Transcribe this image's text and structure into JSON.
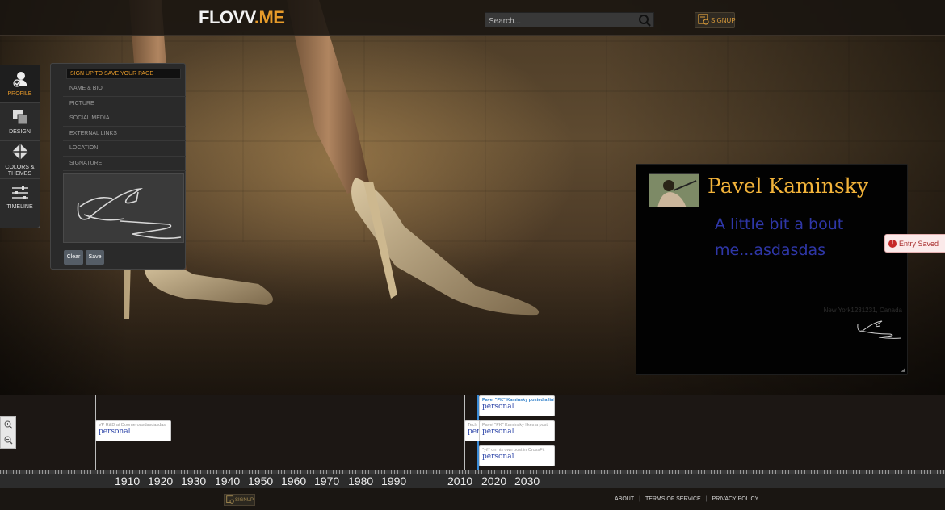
{
  "app": {
    "logo_main": "FLOVV",
    "logo_suffix": ".ME"
  },
  "header": {
    "search_placeholder": "Search...",
    "signup_label": "SIGNUP"
  },
  "sidebar": {
    "items": [
      {
        "label": "PROFILE"
      },
      {
        "label": "DESIGN"
      },
      {
        "label": "COLORS & THEMES"
      },
      {
        "label": "TIMELINE"
      }
    ]
  },
  "profile_panel": {
    "header": "SIGN UP TO SAVE YOUR PAGE",
    "items": [
      "NAME & BIO",
      "PICTURE",
      "SOCIAL MEDIA",
      "EXTERNAL LINKS",
      "LOCATION",
      "SIGNATURE"
    ],
    "clear_label": "Clear",
    "save_label": "Save"
  },
  "card": {
    "name": "Pavel Kaminsky",
    "bio": "A little bit a bout me...asdasdas",
    "location": "New York1231231, Canada"
  },
  "toast": {
    "text": "Entry Saved"
  },
  "timeline": {
    "events": [
      {
        "title": "VP R&D at Doomeroasdasdasdas",
        "tag": "personal"
      },
      {
        "title": "Tech",
        "tag": "per"
      },
      {
        "title": "Pavel \"PK\" Kaminsky posted a link",
        "tag": "personal"
      },
      {
        "title": "Pavel \"PK\" Kaminsky likes a post",
        "tag": "personal"
      },
      {
        "title": "*yi!* on his own post in CrossFit",
        "tag": "personal"
      }
    ],
    "years": [
      "1910",
      "1920",
      "1930",
      "1940",
      "1950",
      "1960",
      "1970",
      "1980",
      "1990",
      "2010",
      "2020",
      "2030"
    ]
  },
  "footer": {
    "signup_label": "SIGNUP",
    "links": [
      "ABOUT",
      "TERMS OF SERVICE",
      "PRIVACY POLICY"
    ]
  },
  "colors": {
    "accent": "#e79b2a",
    "name": "#f2b33a",
    "bio": "#2f37a8",
    "error": "#c62828"
  }
}
